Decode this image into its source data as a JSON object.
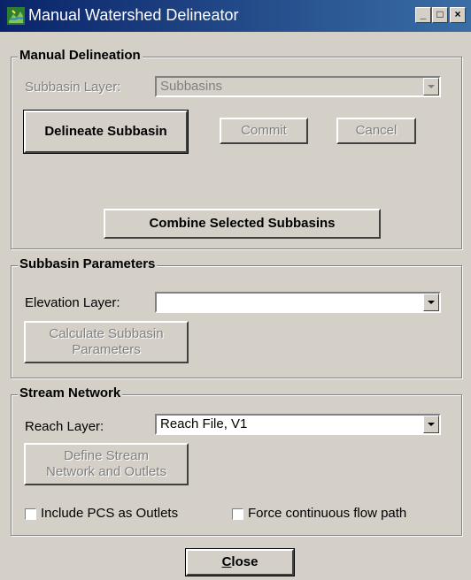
{
  "window": {
    "title": "Manual Watershed Delineator",
    "minimize_glyph": "_",
    "maximize_glyph": "□",
    "close_glyph": "×"
  },
  "manual_delineation": {
    "legend": "Manual Delineation",
    "subbasin_layer_label": "Subbasin Layer:",
    "subbasin_layer_value": "Subbasins",
    "delineate_button": "Delineate Subbasin",
    "commit_button": "Commit",
    "cancel_button": "Cancel",
    "combine_button": "Combine Selected Subbasins"
  },
  "subbasin_parameters": {
    "legend": "Subbasin Parameters",
    "elevation_layer_label": "Elevation Layer:",
    "elevation_layer_value": "",
    "calculate_button_line1": "Calculate Subbasin",
    "calculate_button_line2": "Parameters"
  },
  "stream_network": {
    "legend": "Stream Network",
    "reach_layer_label": "Reach Layer:",
    "reach_layer_value": "Reach File, V1",
    "define_button_line1": "Define Stream",
    "define_button_line2": "Network and Outlets",
    "include_pcs_label": "Include PCS as Outlets",
    "include_pcs_checked": false,
    "force_flow_label": "Force continuous flow path",
    "force_flow_checked": false
  },
  "footer": {
    "close_mnemonic": "C",
    "close_rest": "lose"
  }
}
